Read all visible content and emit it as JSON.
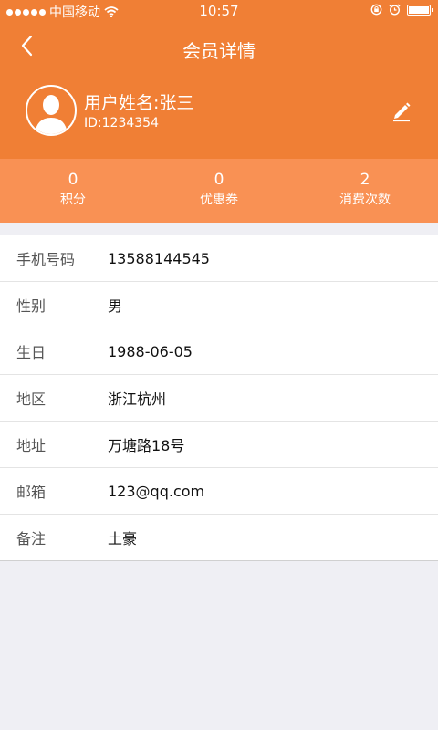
{
  "status_bar": {
    "carrier": "中国移动",
    "time": "10:57"
  },
  "nav": {
    "title": "会员详情"
  },
  "profile": {
    "name": "用户姓名:张三",
    "id": "ID:1234354"
  },
  "stats": [
    {
      "value": "0",
      "label": "积分"
    },
    {
      "value": "0",
      "label": "优惠券"
    },
    {
      "value": "2",
      "label": "消费次数"
    }
  ],
  "details": [
    {
      "label": "手机号码",
      "value": "13588144545"
    },
    {
      "label": "性别",
      "value": "男"
    },
    {
      "label": "生日",
      "value": "1988-06-05"
    },
    {
      "label": "地区",
      "value": "浙江杭州"
    },
    {
      "label": "地址",
      "value": "万塘路18号"
    },
    {
      "label": "邮箱",
      "value": "123@qq.com"
    },
    {
      "label": "备注",
      "value": "土豪"
    }
  ],
  "colors": {
    "header": "#f07f35",
    "stats_bar": "#f99154",
    "background": "#efeff4"
  }
}
